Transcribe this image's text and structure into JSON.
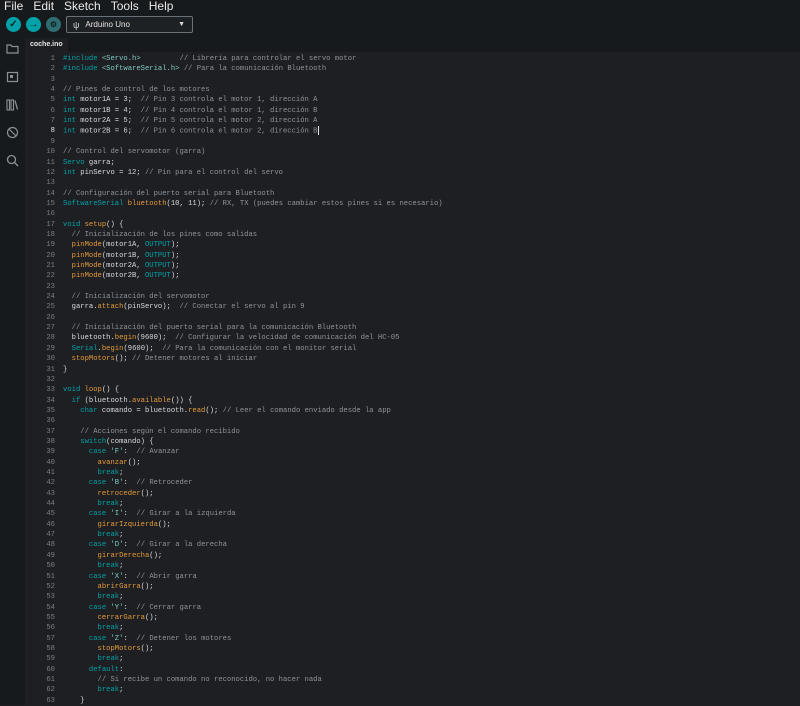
{
  "menu": {
    "file": "File",
    "edit": "Edit",
    "sketch": "Sketch",
    "tools": "Tools",
    "help": "Help"
  },
  "toolbar": {
    "board": "Arduino Uno"
  },
  "tab": {
    "name": "coche.ino"
  },
  "colors": {
    "accent": "#00a2a8",
    "keyword": "#00a2a8",
    "function": "#e49a3a",
    "comment": "#8e9499"
  },
  "code": [
    "#include <Servo.h>         // Librería para controlar el servo motor",
    "#include <SoftwareSerial.h> // Para la comunicación Bluetooth",
    "",
    "// Pines de control de los motores",
    "int motor1A = 3;  // Pin 3 controla el motor 1, dirección A",
    "int motor1B = 4;  // Pin 4 controla el motor 1, dirección B",
    "int motor2A = 5;  // Pin 5 controla el motor 2, dirección A",
    "int motor2B = 6;  // Pin 6 controla el motor 2, dirección B",
    "",
    "// Control del servomotor (garra)",
    "Servo garra;",
    "int pinServo = 12; // Pin para el control del servo",
    "",
    "// Configuración del puerto serial para Bluetooth",
    "SoftwareSerial bluetooth(10, 11); // RX, TX (puedes cambiar estos pines si es necesario)",
    "",
    "void setup() {",
    "  // Inicialización de los pines como salidas",
    "  pinMode(motor1A, OUTPUT);",
    "  pinMode(motor1B, OUTPUT);",
    "  pinMode(motor2A, OUTPUT);",
    "  pinMode(motor2B, OUTPUT);",
    "",
    "  // Inicialización del servomotor",
    "  garra.attach(pinServo);  // Conectar el servo al pin 9",
    "",
    "  // Inicialización del puerto serial para la comunicación Bluetooth",
    "  bluetooth.begin(9600);  // Configurar la velocidad de comunicación del HC-05",
    "  Serial.begin(9600);  // Para la comunicación con el monitor serial",
    "  stopMotors(); // Detener motores al iniciar",
    "}",
    "",
    "void loop() {",
    "  if (bluetooth.available()) {",
    "    char comando = bluetooth.read(); // Leer el comando enviado desde la app",
    "",
    "    // Acciones según el comando recibido",
    "    switch(comando) {",
    "      case 'F':  // Avanzar",
    "        avanzar();",
    "        break;",
    "      case 'B':  // Retroceder",
    "        retroceder();",
    "        break;",
    "      case 'I':  // Girar a la izquierda",
    "        girarIzquierda();",
    "        break;",
    "      case 'D':  // Girar a la derecha",
    "        girarDerecha();",
    "        break;",
    "      case 'X':  // Abrir garra",
    "        abrirGarra();",
    "        break;",
    "      case 'Y':  // Cerrar garra",
    "        cerrarGarra();",
    "        break;",
    "      case 'Z':  // Detener los motores",
    "        stopMotors();",
    "        break;",
    "      default:",
    "        // Si recibe un comando no reconocido, no hacer nada",
    "        break;",
    "    }"
  ]
}
